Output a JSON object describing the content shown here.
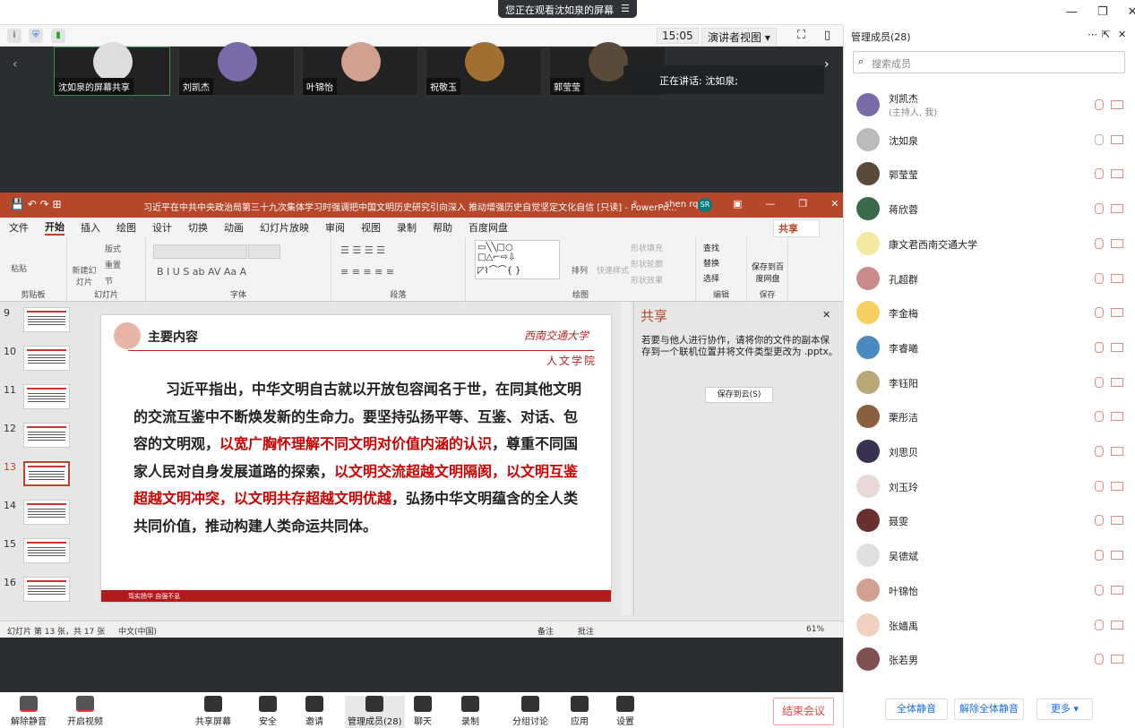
{
  "banner": {
    "text": "您正在观看沈如泉的屏幕"
  },
  "toolbar": {
    "time": "15:05",
    "view": "演讲者视图"
  },
  "tiles": [
    {
      "name": "沈如泉的屏幕共享"
    },
    {
      "name": "刘凯杰"
    },
    {
      "name": "叶锦怡"
    },
    {
      "name": "祝敬玉"
    },
    {
      "name": "郭莹莹"
    }
  ],
  "speaking": "正在讲话: 沈如泉;",
  "ppt": {
    "title": "习近平在中共中央政治局第三十九次集体学习时强调把中国文明历史研究引向深入 推动增强历史自觉坚定文化自信 [只读] - PowerPo...",
    "user": "shen rq",
    "avatar": "SR",
    "menu": [
      "文件",
      "开始",
      "插入",
      "绘图",
      "设计",
      "切换",
      "动画",
      "幻灯片放映",
      "审阅",
      "视图",
      "录制",
      "帮助",
      "百度网盘"
    ],
    "share": "共享",
    "groups": {
      "clipboard": "剪贴板",
      "slides": "幻灯片",
      "font": "字体",
      "paragraph": "段落",
      "drawing": "绘图",
      "editing": "编辑",
      "save": "保存"
    },
    "ribbon": {
      "paste": "粘贴",
      "new_slide": "新建幻灯片",
      "layout": "版式",
      "reset": "重置",
      "section": "节",
      "arrange": "排列",
      "quick_style": "快速样式",
      "fill": "形状填充",
      "outline": "形状轮廓",
      "effect": "形状效果",
      "find": "查找",
      "replace": "替换",
      "select": "选择",
      "save_baidu": "保存到百度网盘"
    },
    "thumbs": [
      "9",
      "10",
      "11",
      "12",
      "13",
      "14",
      "15",
      "16"
    ],
    "slide": {
      "heading": "主要内容",
      "logo": "西南交通大学",
      "college": "人文学院",
      "body": [
        {
          "t": "习近平指出，中华文明自古就以开放包容闻名于世，在同其他文明的交流互鉴中不断焕发新的生命力。要坚持弘扬平等、互鉴、对话、包容的文明观，",
          "red": false
        },
        {
          "t": "以宽广胸怀理解不同文明对价值内涵的认识",
          "red": true
        },
        {
          "t": "，尊重不同国家人民对自身发展道路的探索，",
          "red": false
        },
        {
          "t": "以文明交流超越文明隔阂，以文明互鉴超越文明冲突，以文明共存超越文明优越",
          "red": true
        },
        {
          "t": "，弘扬中华文明蕴含的全人类共同价值，推动构建人类命运共同体。",
          "red": false
        }
      ],
      "footer": "笃实扬华   自强不息"
    },
    "pane": {
      "title": "共享",
      "desc": "若要与他人进行协作，请将你的文件的副本保存到一个联机位置并将文件类型更改为 .pptx。",
      "button": "保存到云(S)"
    },
    "status": {
      "slide": "幻灯片 第 13 张，共 17 张",
      "lang": "中文(中国)",
      "notes": "备注",
      "comments": "批注",
      "zoom": "61%"
    }
  },
  "bottom": [
    {
      "label": "解除静音"
    },
    {
      "label": "开启视频"
    },
    {
      "label": "共享屏幕"
    },
    {
      "label": "安全"
    },
    {
      "label": "邀请"
    },
    {
      "label": "管理成员(28)"
    },
    {
      "label": "聊天"
    },
    {
      "label": "录制"
    },
    {
      "label": "分组讨论"
    },
    {
      "label": "应用"
    },
    {
      "label": "设置"
    }
  ],
  "end_meeting": "结束会议",
  "panel": {
    "title": "管理成员(28)",
    "search_placeholder": "搜索成员",
    "members": [
      {
        "name": "刘凯杰",
        "sub": "(主持人, 我)",
        "color": "#7a6aa8"
      },
      {
        "name": "沈如泉",
        "color": "#bbb"
      },
      {
        "name": "郭莹莹",
        "color": "#5a4a3a"
      },
      {
        "name": "蒋欣蓉",
        "color": "#3a6a4a"
      },
      {
        "name": "康文君西南交通大学",
        "color": "#f3e9a0"
      },
      {
        "name": "孔超群",
        "color": "#c98a8a"
      },
      {
        "name": "李金梅",
        "color": "#f5d060"
      },
      {
        "name": "李睿曦",
        "color": "#4a8ac0"
      },
      {
        "name": "李钰阳",
        "color": "#b8a878"
      },
      {
        "name": "栗彤洁",
        "color": "#8a6040"
      },
      {
        "name": "刘思贝",
        "color": "#3a3050"
      },
      {
        "name": "刘玉玲",
        "color": "#e8d8d8"
      },
      {
        "name": "聂雯",
        "color": "#6a3030"
      },
      {
        "name": "吴德斌",
        "color": "#e0e0e0"
      },
      {
        "name": "叶锦怡",
        "color": "#d0a090"
      },
      {
        "name": "张嫱禹",
        "color": "#f0d0c0"
      },
      {
        "name": "张若男",
        "color": "#805050"
      }
    ],
    "mute_all": "全体静音",
    "unmute_all": "解除全体静音",
    "more": "更多 ▾"
  }
}
